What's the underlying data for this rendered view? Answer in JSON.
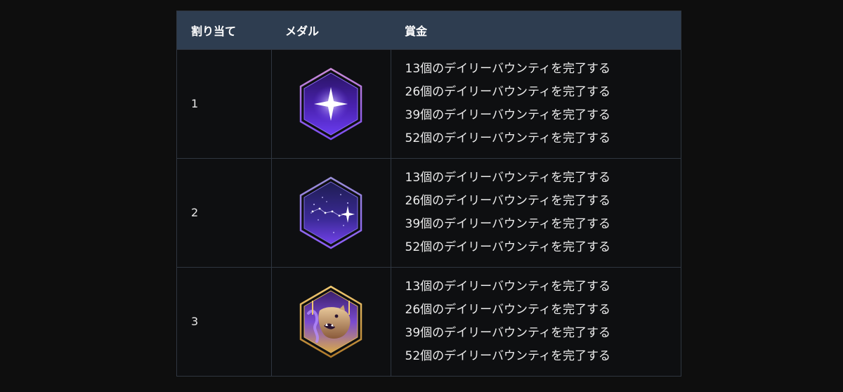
{
  "table": {
    "headers": {
      "assignment": "割り当て",
      "medal": "メダル",
      "reward": "賞金"
    },
    "rows": [
      {
        "assignment": "1",
        "medal_icon": "hexagon-sparkle-medal-icon",
        "rewards": [
          "13個のデイリーバウンティを完了する",
          "26個のデイリーバウンティを完了する",
          "39個のデイリーバウンティを完了する",
          "52個のデイリーバウンティを完了する"
        ]
      },
      {
        "assignment": "2",
        "medal_icon": "hexagon-constellation-medal-icon",
        "rewards": [
          "13個のデイリーバウンティを完了する",
          "26個のデイリーバウンティを完了する",
          "39個のデイリーバウンティを完了する",
          "52個のデイリーバウンティを完了する"
        ]
      },
      {
        "assignment": "3",
        "medal_icon": "hexagon-bear-medal-icon",
        "rewards": [
          "13個のデイリーバウンティを完了する",
          "26個のデイリーバウンティを完了する",
          "39個のデイリーバウンティを完了する",
          "52個のデイリーバウンティを完了する"
        ]
      }
    ]
  },
  "colors": {
    "page_background": "#0e0e0e",
    "header_background": "#2e3d50",
    "border": "#2f3640",
    "medal_purple": "#5b2fc9",
    "medal_gold": "#d9a94a"
  }
}
